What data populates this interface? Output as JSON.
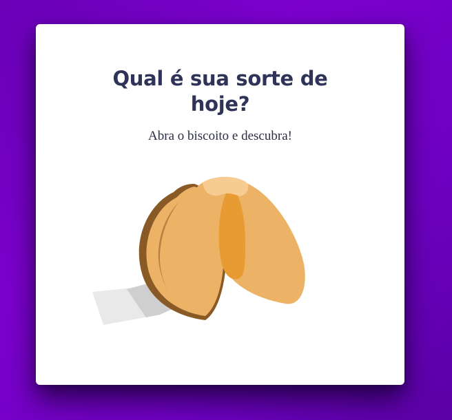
{
  "card": {
    "title_line1": "Qual é sua sorte de",
    "title_line2": "hoje?",
    "subtitle": "Abra o biscoito e descubra!"
  },
  "cookie": {
    "icon": "fortune-cookie-icon",
    "colors": {
      "dough": "#ecb366",
      "shadow": "#8a5a26",
      "inner": "#e89b32",
      "highlight": "#f7cc93",
      "paper_light": "#e9e9e9",
      "paper_dark": "#cfcfcf"
    }
  },
  "colors": {
    "background": "#7400c4",
    "card": "#ffffff",
    "title": "#2f3357"
  }
}
